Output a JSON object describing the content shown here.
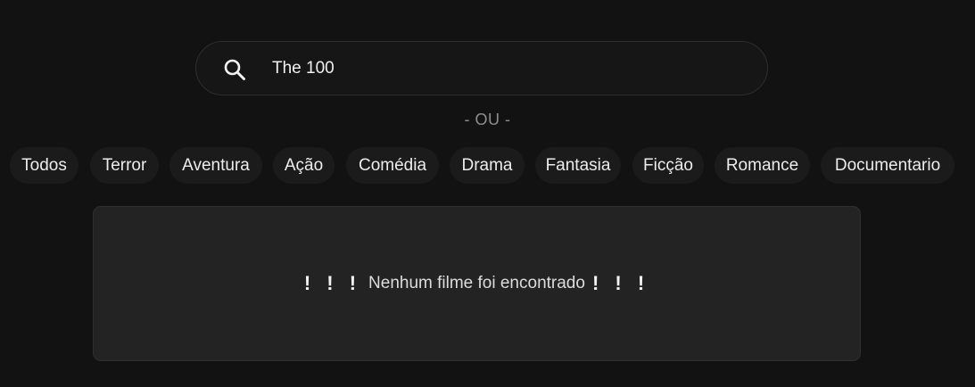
{
  "search": {
    "value": "The 100",
    "icon": "search-icon"
  },
  "divider": {
    "label": "- OU -"
  },
  "genres": [
    {
      "label": "Todos"
    },
    {
      "label": "Terror"
    },
    {
      "label": "Aventura"
    },
    {
      "label": "Ação"
    },
    {
      "label": "Comédia"
    },
    {
      "label": "Drama"
    },
    {
      "label": "Fantasia"
    },
    {
      "label": "Ficção"
    },
    {
      "label": "Romance"
    },
    {
      "label": "Documentario"
    }
  ],
  "results": {
    "empty_prefix": "! ! !",
    "empty_message": "Nenhum filme foi encontrado",
    "empty_suffix": "! ! !"
  },
  "colors": {
    "background": "#121212",
    "pill": "#1b1b1b",
    "panel": "#232323",
    "muted": "#8e8e8e"
  }
}
